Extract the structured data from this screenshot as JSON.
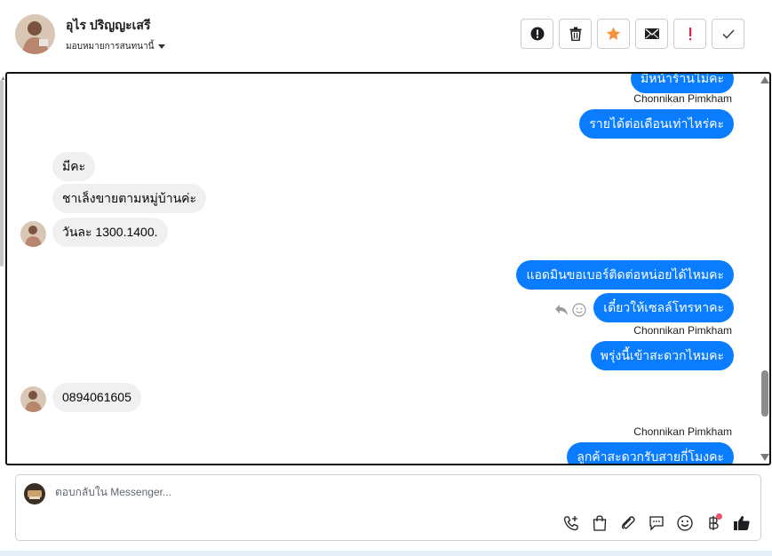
{
  "header": {
    "contact_name": "อุไร ปริญญะเสรี",
    "assign_label": "มอบหมายการสนทนานี้",
    "actions": [
      {
        "name": "spam-button",
        "icon": "alert-circle-icon"
      },
      {
        "name": "delete-button",
        "icon": "trash-icon"
      },
      {
        "name": "star-button",
        "icon": "star-icon"
      },
      {
        "name": "mark-unread-button",
        "icon": "envelope-icon"
      },
      {
        "name": "follow-up-button",
        "icon": "exclamation-icon"
      },
      {
        "name": "done-button",
        "icon": "check-icon"
      }
    ]
  },
  "messages": {
    "m1": "มีหน้าร้านไม่คะ",
    "sender1": "Chonnikan Pimkham",
    "m2": "รายได้ต่อเดือนเท่าไหร่คะ",
    "m3": "มีคะ",
    "m4": "ชาเล็งขายตามหมู่บ้านค่ะ",
    "m5": "วันละ 1300.1400.",
    "m6": "แอดมินขอเบอร์ติดต่อหน่อยได้ไหมคะ",
    "m7": "เดี๋ยวให้เซลล์โทรหาคะ",
    "sender2": "Chonnikan Pimkham",
    "m8": "พรุ่งนี้เข้าสะดวกไหมคะ",
    "m9": "0894061605",
    "sender3": "Chonnikan Pimkham",
    "m10": "ลูกค้าสะดวกรับสายกี่โมงคะ"
  },
  "composer": {
    "placeholder": "ตอบกลับใน Messenger..."
  },
  "colors": {
    "outgoing_bubble": "#0a7cff",
    "incoming_bubble": "#f0f0f0",
    "star": "#f7923a",
    "follow_up": "#e41e3f"
  }
}
